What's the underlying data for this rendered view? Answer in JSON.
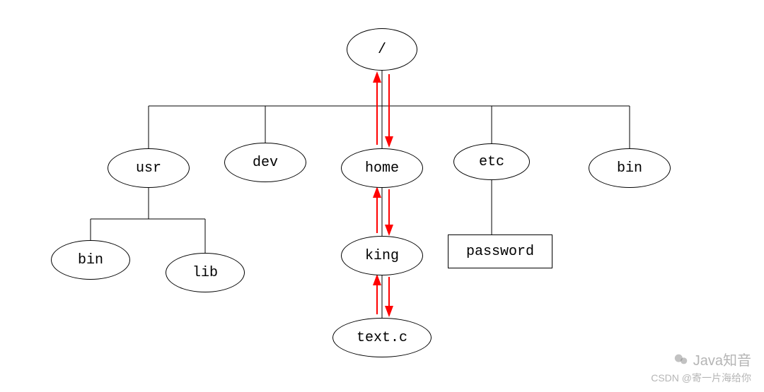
{
  "tree": {
    "root": {
      "label": "/"
    },
    "level1": {
      "usr": {
        "label": "usr"
      },
      "dev": {
        "label": "dev"
      },
      "home": {
        "label": "home"
      },
      "etc": {
        "label": "etc"
      },
      "bin": {
        "label": "bin"
      }
    },
    "usr_children": {
      "bin": {
        "label": "bin"
      },
      "lib": {
        "label": "lib"
      }
    },
    "home_children": {
      "king": {
        "label": "king"
      }
    },
    "king_children": {
      "textc": {
        "label": "text.c"
      }
    },
    "etc_children": {
      "password": {
        "label": "password"
      }
    }
  },
  "watermarks": {
    "brand": "Java知音",
    "attribution": "CSDN @寄一片海给你"
  },
  "chart_data": {
    "type": "tree",
    "title": "",
    "root": "/",
    "nodes": [
      {
        "id": "root",
        "label": "/",
        "shape": "ellipse"
      },
      {
        "id": "usr",
        "label": "usr",
        "shape": "ellipse"
      },
      {
        "id": "dev",
        "label": "dev",
        "shape": "ellipse"
      },
      {
        "id": "home",
        "label": "home",
        "shape": "ellipse"
      },
      {
        "id": "etc",
        "label": "etc",
        "shape": "ellipse"
      },
      {
        "id": "bin_top",
        "label": "bin",
        "shape": "ellipse"
      },
      {
        "id": "bin_usr",
        "label": "bin",
        "shape": "ellipse"
      },
      {
        "id": "lib",
        "label": "lib",
        "shape": "ellipse"
      },
      {
        "id": "king",
        "label": "king",
        "shape": "ellipse"
      },
      {
        "id": "textc",
        "label": "text.c",
        "shape": "ellipse"
      },
      {
        "id": "password",
        "label": "password",
        "shape": "rect"
      }
    ],
    "edges": [
      {
        "from": "root",
        "to": "usr"
      },
      {
        "from": "root",
        "to": "dev"
      },
      {
        "from": "root",
        "to": "home",
        "bidirectional_highlight": true
      },
      {
        "from": "root",
        "to": "etc"
      },
      {
        "from": "root",
        "to": "bin_top"
      },
      {
        "from": "usr",
        "to": "bin_usr"
      },
      {
        "from": "usr",
        "to": "lib"
      },
      {
        "from": "home",
        "to": "king",
        "bidirectional_highlight": true
      },
      {
        "from": "king",
        "to": "textc",
        "bidirectional_highlight": true
      },
      {
        "from": "etc",
        "to": "password"
      }
    ],
    "highlighted_path": [
      "root",
      "home",
      "king",
      "textc"
    ],
    "highlight_color": "#ff0000"
  }
}
